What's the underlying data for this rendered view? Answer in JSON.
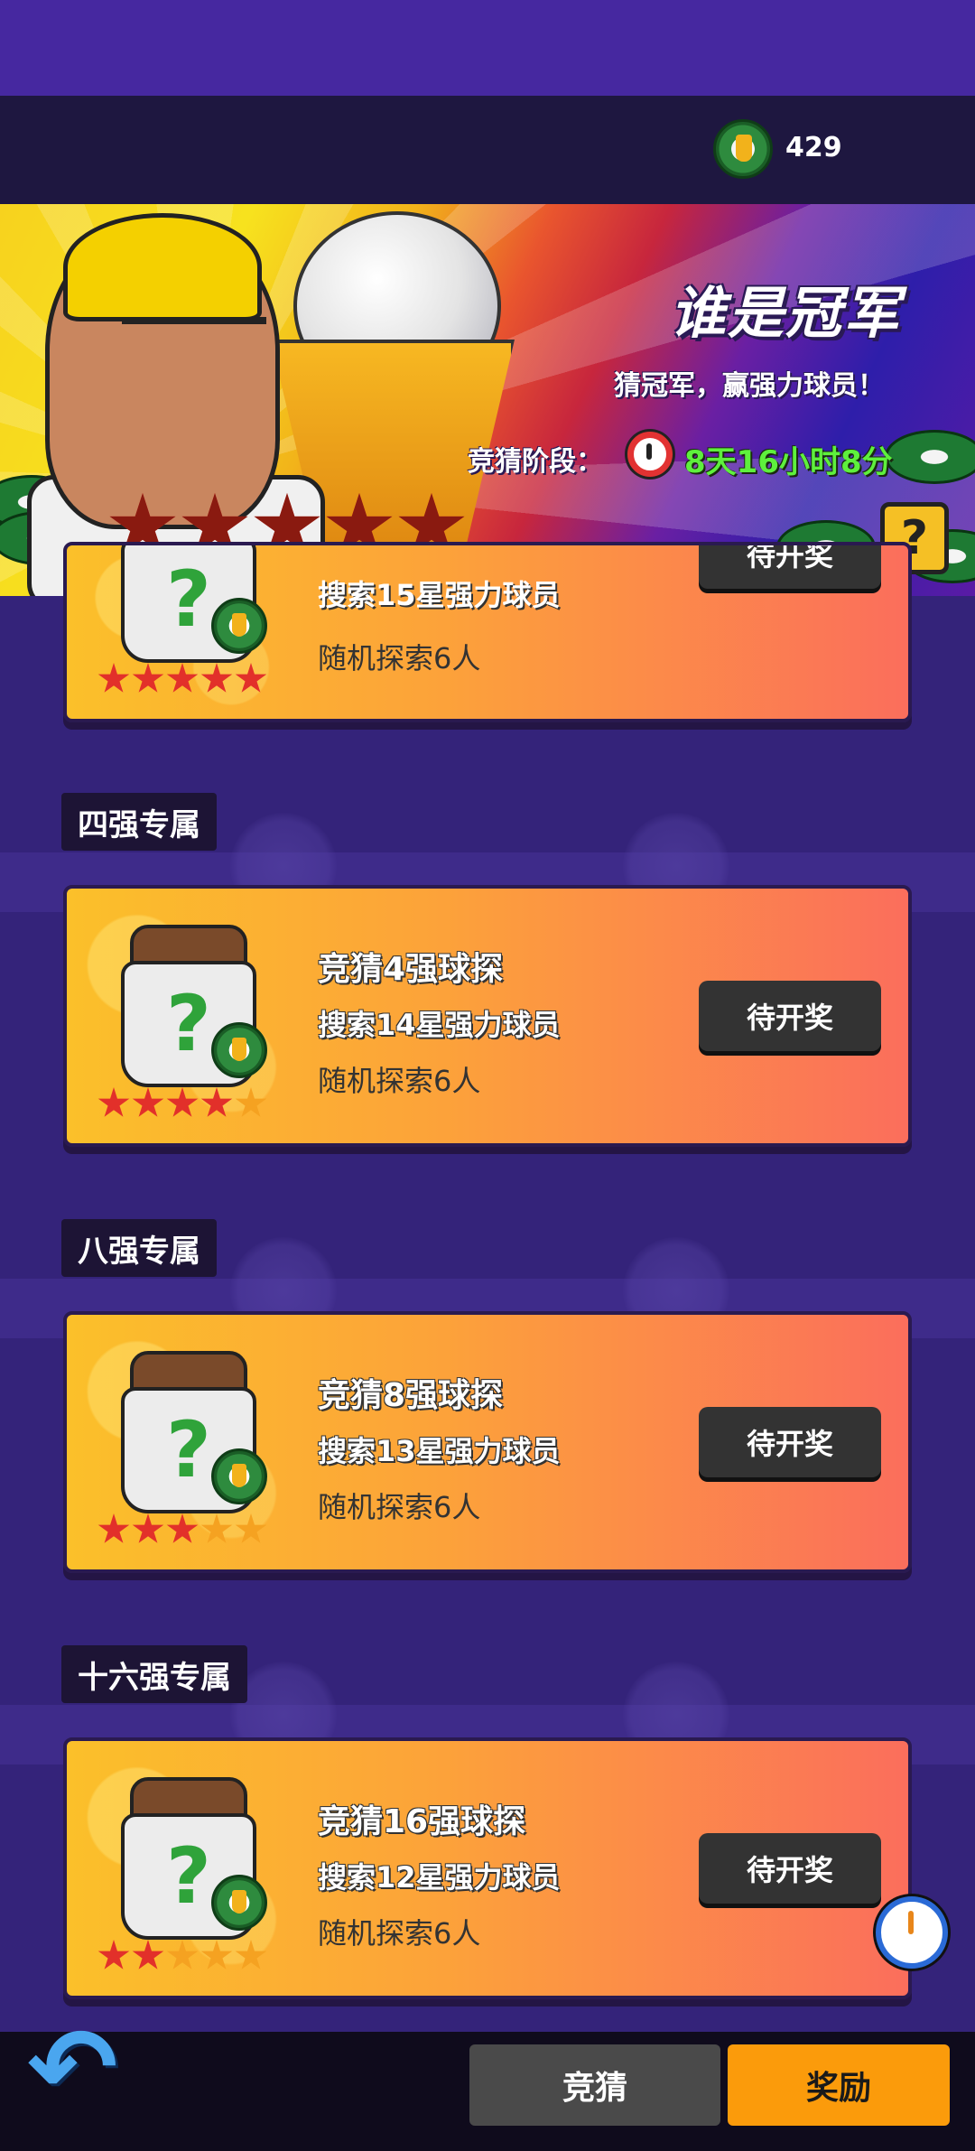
{
  "header": {
    "currency_value": "429",
    "currency_icon": "trophy-coin-icon"
  },
  "banner": {
    "title": "谁是冠军",
    "subtitle": "猜冠军，赢强力球员！",
    "stage_label": "竞猜阶段：",
    "countdown": "8天16小时8分",
    "help_label": "?",
    "star_count": 5
  },
  "partial_card": {
    "line2": "搜索15星强力球员",
    "line3": "随机探索6人",
    "stars_on": 5,
    "button_label": "待开奖"
  },
  "sections": [
    {
      "tag": "四强专属",
      "card": {
        "title": "竞猜4强球探",
        "line2": "搜索14星强力球员",
        "line3": "随机探索6人",
        "stars_on": 4,
        "button_label": "待开奖"
      }
    },
    {
      "tag": "八强专属",
      "card": {
        "title": "竞猜8强球探",
        "line2": "搜索13星强力球员",
        "line3": "随机探索6人",
        "stars_on": 3,
        "button_label": "待开奖"
      }
    },
    {
      "tag": "十六强专属",
      "card": {
        "title": "竞猜16强球探",
        "line2": "搜索12星强力球员",
        "line3": "随机探索6人",
        "stars_on": 2,
        "button_label": "待开奖"
      }
    }
  ],
  "mystery_symbol": "?",
  "bottom_nav": {
    "back_label": "↶",
    "tab_guess": "竞猜",
    "tab_reward": "奖励"
  },
  "colors": {
    "card_gradient_start": "#fbc02a",
    "card_gradient_end": "#fb6e5c",
    "active_tab": "#fb9b0b",
    "countdown_green": "#5ef03d",
    "star_red": "#e2302a"
  }
}
